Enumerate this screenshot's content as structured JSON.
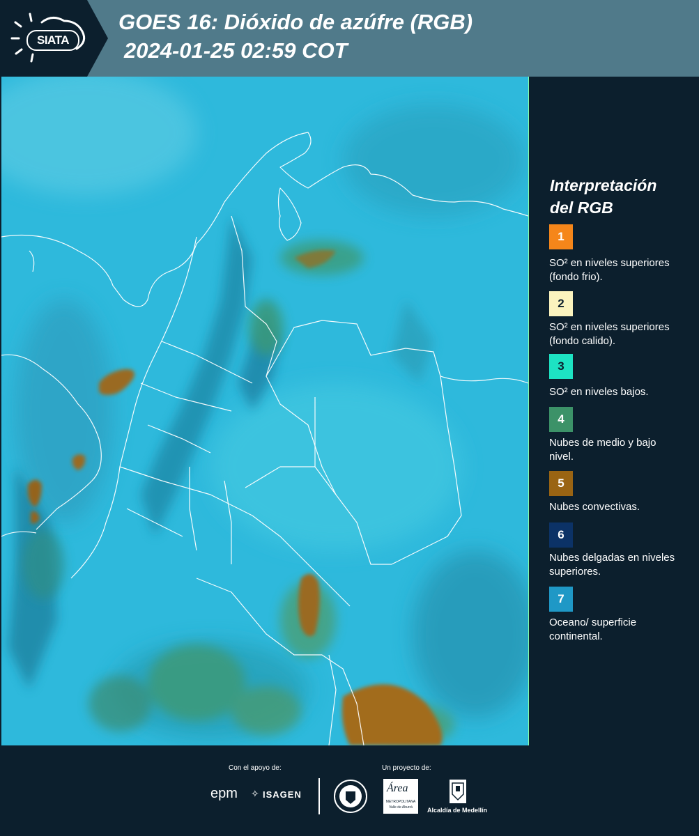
{
  "header": {
    "logo": "SIATA",
    "title_line1": "GOES 16: Dióxido de azúfre (RGB)",
    "title_line2": "2024-01-25 02:59 COT"
  },
  "legend": {
    "title_line1": "Interpretación",
    "title_line2": "del RGB",
    "items": [
      {
        "number": "1",
        "color": "#f5861a",
        "text": "SO² en niveles superiores (fondo frio)."
      },
      {
        "number": "2",
        "color": "#fbf3be",
        "text": "SO² en niveles superiores (fondo calido)."
      },
      {
        "number": "3",
        "color": "#1de3c3",
        "text": "SO² en niveles bajos."
      },
      {
        "number": "4",
        "color": "#3c9268",
        "text": "Nubes de medio y bajo nivel."
      },
      {
        "number": "5",
        "color": "#9a6413",
        "text": "Nubes convectivas."
      },
      {
        "number": "6",
        "color": "#0c3266",
        "text": "Nubes delgadas en niveles superiores."
      },
      {
        "number": "7",
        "color": "#1f98c6",
        "text": "Oceano/ superficie continental."
      }
    ]
  },
  "footer": {
    "support_label": "Con el apoyo de:",
    "project_label": "Un proyecto de:",
    "logo_epm": "epm",
    "logo_isagen": "ISAGEN",
    "logo_area_main": "Área",
    "logo_area_sub": "METROPOLITANA",
    "logo_area_sub2": "Valle de Aburrá",
    "logo_alcaldia": "Alcaldía de Medellín"
  },
  "colors": {
    "header_bg": "#507a8a",
    "panel_bg": "#0c1f2d",
    "map_base": "#2cb9dc"
  }
}
